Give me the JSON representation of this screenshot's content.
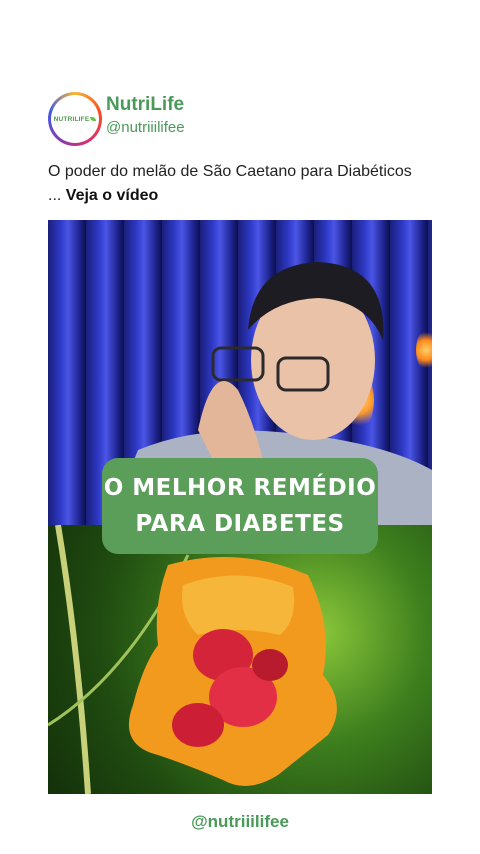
{
  "profile": {
    "avatar_text": "NUTRILIFE",
    "name": "NutriLife",
    "handle": "@nutriiilifee"
  },
  "post": {
    "caption": "O poder do melão de São Caetano para Diabéticos ...",
    "caption_cta": "Veja o vídeo"
  },
  "video": {
    "overlay_line1": "O MELHOR REMÉDIO",
    "overlay_line2": "PARA DIABETES"
  },
  "footer": {
    "handle": "@nutriiilifee"
  },
  "colors": {
    "brand_green": "#4a9a5a",
    "overlay_green": "#5a9e5a"
  }
}
